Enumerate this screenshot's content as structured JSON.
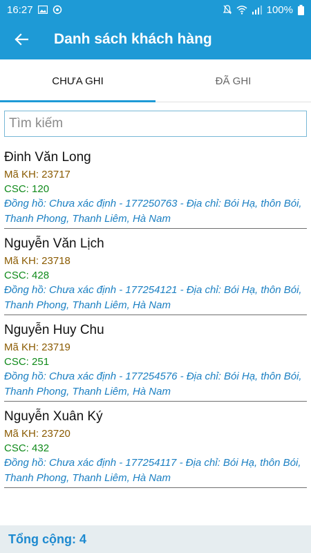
{
  "status_bar": {
    "time": "16:27",
    "battery": "100%",
    "icons_left": [
      "image-icon",
      "sync-icon"
    ],
    "icons_right": [
      "silent-icon",
      "wifi-icon",
      "signal-icon"
    ]
  },
  "app_bar": {
    "title": "Danh sách khách hàng",
    "back_icon": "arrow-left-icon",
    "color": "#1e9ad6"
  },
  "tabs": [
    {
      "label": "CHƯA GHI",
      "active": true
    },
    {
      "label": "ĐÃ GHI",
      "active": false
    }
  ],
  "search": {
    "placeholder": "Tìm kiếm",
    "value": ""
  },
  "customers": [
    {
      "name": "Đinh Văn Long",
      "code": "Mã KH: 23717",
      "csc": "CSC: 120",
      "meter": "Đồng hồ: Chưa xác định - 177250763 - Địa chỉ: Bói Hạ, thôn Bói, Thanh Phong, Thanh Liêm, Hà Nam"
    },
    {
      "name": "Nguyễn Văn Lịch",
      "code": "Mã KH: 23718",
      "csc": "CSC: 428",
      "meter": "Đồng hồ: Chưa xác định - 177254121 - Địa chỉ: Bói Hạ, thôn Bói, Thanh Phong, Thanh Liêm, Hà Nam"
    },
    {
      "name": "Nguyễn Huy Chu",
      "code": "Mã KH: 23719",
      "csc": "CSC: 251",
      "meter": "Đồng hồ: Chưa xác định - 177254576 - Địa chỉ: Bói Hạ, thôn Bói, Thanh Phong, Thanh Liêm, Hà Nam"
    },
    {
      "name": "Nguyễn Xuân Ký",
      "code": "Mã KH: 23720",
      "csc": "CSC: 432",
      "meter": "Đồng hồ: Chưa xác định - 177254117 - Địa chỉ: Bói Hạ, thôn Bói, Thanh Phong, Thanh Liêm, Hà Nam"
    }
  ],
  "footer": {
    "total": "Tổng cộng: 4"
  }
}
